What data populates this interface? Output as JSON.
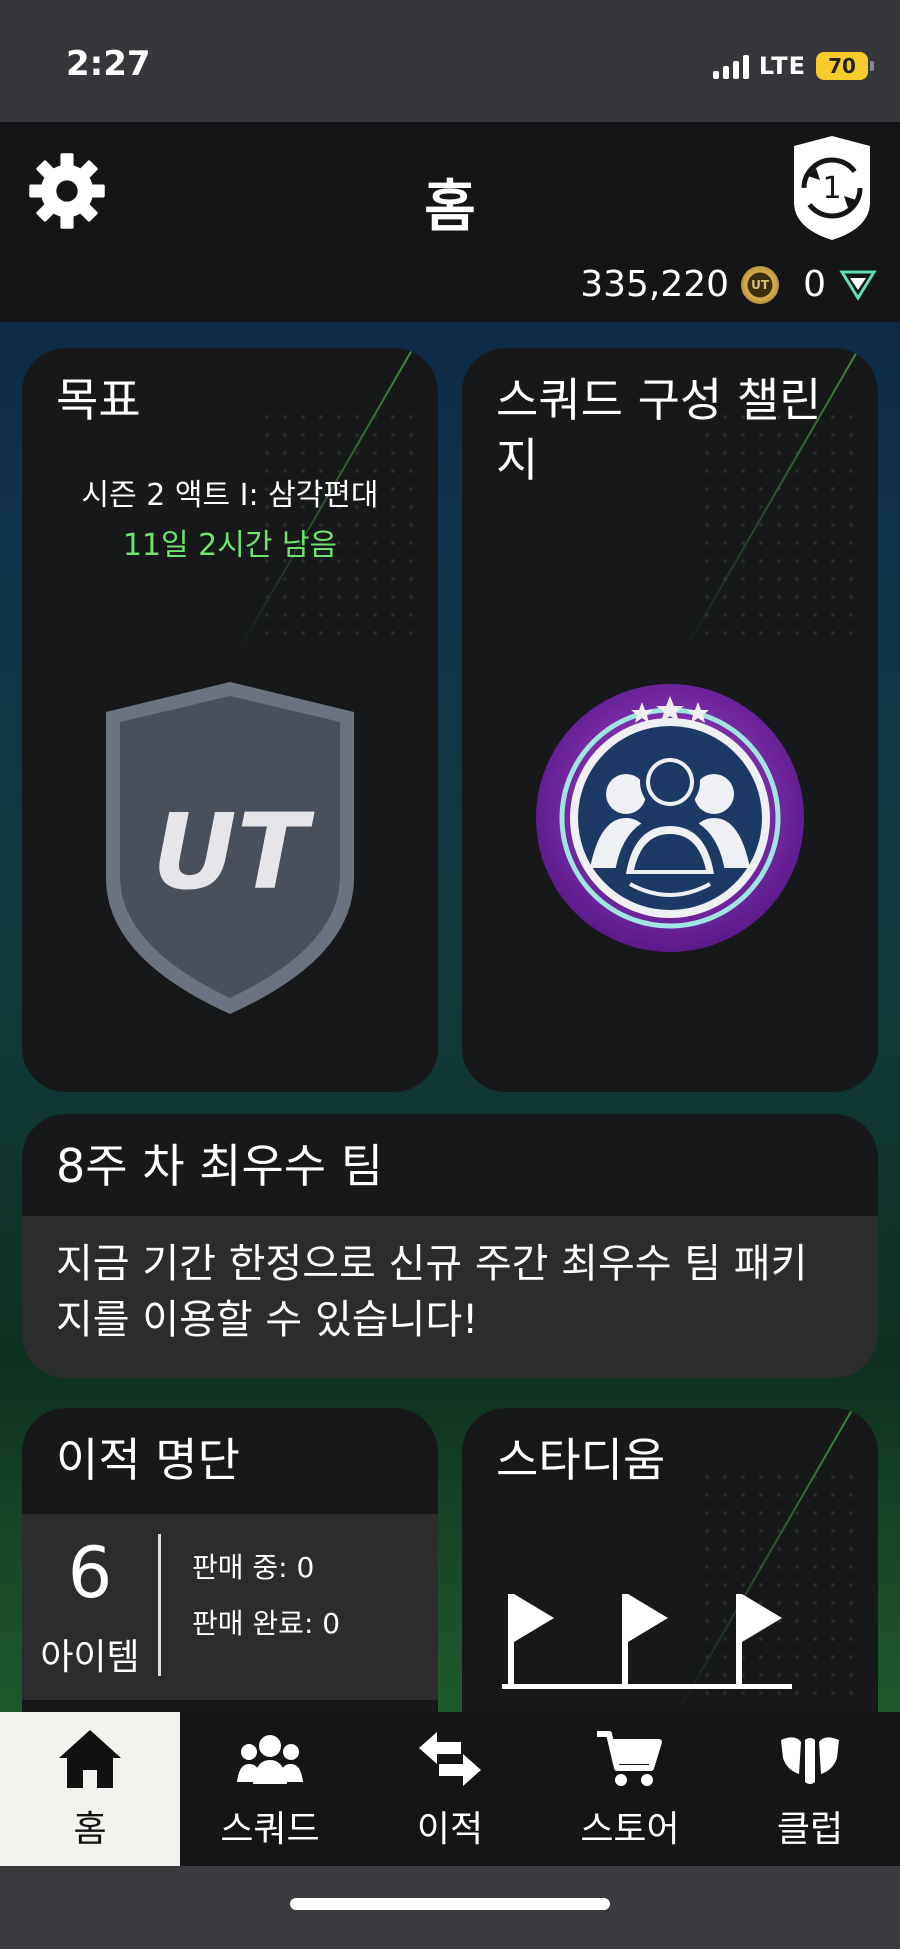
{
  "status_bar": {
    "time": "2:27",
    "network": "LTE",
    "battery": "70"
  },
  "header": {
    "title": "홈",
    "coins": "335,220",
    "coin_symbol": "UT",
    "points": "0",
    "badge_number": "1"
  },
  "objectives": {
    "title": "목표",
    "season_line": "시즌 2 액트 I: 삼각편대",
    "remaining": "11일 2시간 남음",
    "emblem_text": "UT"
  },
  "sbc": {
    "title": "스쿼드 구성 챌린지"
  },
  "totw": {
    "title": "8주 차 최우수 팀",
    "description": "지금 기간 한정으로 신규 주간 최우수 팀 패키지를 이용할 수 있습니다!"
  },
  "transfer_list": {
    "title": "이적 명단",
    "count": "6",
    "items_label": "아이템",
    "on_sale": "판매 중: 0",
    "sold": "판매 완료: 0"
  },
  "stadium": {
    "title": "스타디움"
  },
  "nav": {
    "items": [
      {
        "label": "홈",
        "icon": "home-icon",
        "active": true
      },
      {
        "label": "스쿼드",
        "icon": "squad-icon",
        "active": false
      },
      {
        "label": "이적",
        "icon": "transfer-icon",
        "active": false
      },
      {
        "label": "스토어",
        "icon": "cart-icon",
        "active": false
      },
      {
        "label": "클럽",
        "icon": "club-icon",
        "active": false
      }
    ]
  },
  "colors": {
    "accent_green": "#6ee46e",
    "coin_gold": "#d8b150",
    "sbc_purple": "#8a2fb8"
  }
}
